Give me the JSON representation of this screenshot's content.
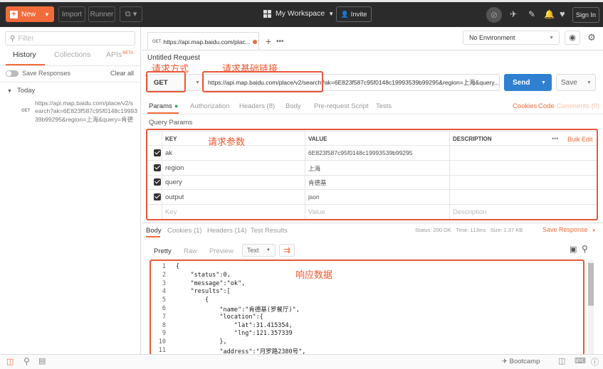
{
  "toolbar": {
    "new_label": "New",
    "import_label": "Import",
    "runner_label": "Runner",
    "workspace_label": "My Workspace",
    "invite_label": "Invite",
    "signin_label": "Sign In"
  },
  "sidebar": {
    "filter_placeholder": "Filter",
    "tabs": [
      {
        "label": "History"
      },
      {
        "label": "Collections"
      },
      {
        "label": "APIs",
        "badge": "BETA"
      }
    ],
    "save_responses_label": "Save Responses",
    "clear_all_label": "Clear all",
    "group_label": "Today",
    "history_item": {
      "method": "GET",
      "lines": [
        "https://api.map.baidu.com/place/v2/s",
        "earch?ak=6E823f587c95f0148c199935",
        "39b99295&region=上海&query=肯德"
      ]
    }
  },
  "request_tab": {
    "method": "GET",
    "title": "https://api.map.baidu.com/plac..."
  },
  "environment": {
    "selected": "No Environment"
  },
  "request": {
    "name": "Untitled Request",
    "method": "GET",
    "url": "https://api.map.baidu.com/place/v2/search?ak=6E823f587c95f0148c19993539b99295&region=上海&query...",
    "send_label": "Send",
    "save_label": "Save"
  },
  "request_tabs": {
    "params": "Params",
    "authorization": "Authorization",
    "headers": "Headers (8)",
    "body": "Body",
    "prerequest": "Pre-request Script",
    "tests": "Tests",
    "cookies": "Cookies",
    "code": "Code",
    "comments": "Comments (0)"
  },
  "query_params": {
    "title": "Query Params",
    "columns": [
      "KEY",
      "VALUE",
      "DESCRIPTION"
    ],
    "more": "•••",
    "bulk_edit": "Bulk Edit",
    "rows": [
      {
        "key": "ak",
        "value": "6E823f587c95f0148c19993539b99295"
      },
      {
        "key": "region",
        "value": "上海"
      },
      {
        "key": "query",
        "value": "肯德基"
      },
      {
        "key": "output",
        "value": "json"
      }
    ],
    "placeholder": {
      "key": "Key",
      "value": "Value",
      "description": "Description"
    }
  },
  "response": {
    "tabs": [
      "Body",
      "Cookies (1)",
      "Headers (14)",
      "Test Results"
    ],
    "status": "Status: 200 OK",
    "time": "Time: 113ms",
    "size": "Size: 1.37 KB",
    "save_response": "Save Response",
    "views": [
      "Pretty",
      "Raw",
      "Preview"
    ],
    "format": "Text",
    "line_numbers": [
      "1",
      "2",
      "3",
      "4",
      "5",
      "6",
      "7",
      "8",
      "9",
      "10",
      "11"
    ],
    "code_lines": [
      "{",
      "    \"status\":0,",
      "    \"message\":\"ok\",",
      "    \"results\":[",
      "        {",
      "            \"name\":\"肯德基(罗餐厅)\",",
      "            \"location\":{",
      "                \"lat\":31.415354,",
      "                \"lng\":121.357339",
      "            },",
      "            \"address\":\"月罗路2380号\","
    ]
  },
  "annotations": {
    "method": "请求方式",
    "url": "请求基础链接",
    "params": "请求参数",
    "response": "响应数据"
  },
  "bottom": {
    "bootcamp": "Bootcamp"
  },
  "colors": {
    "accent": "#f26b3a",
    "send": "#2f80d1",
    "annotation": "#e8573a"
  }
}
